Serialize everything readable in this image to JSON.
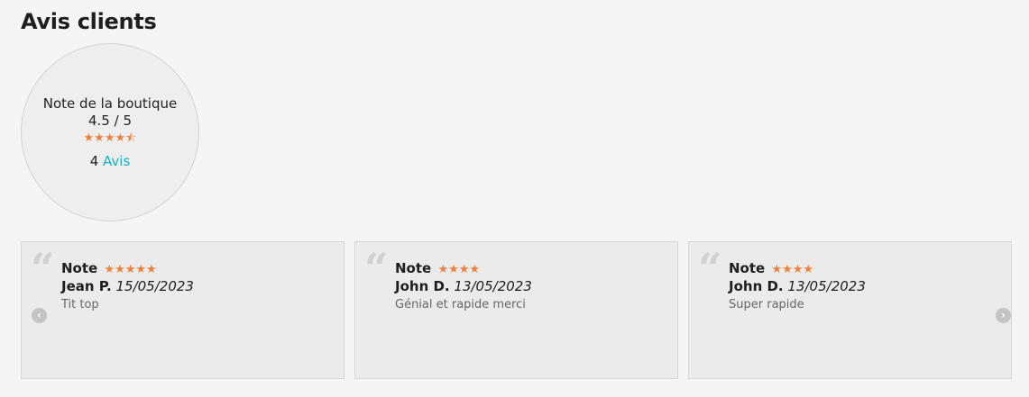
{
  "heading": "Avis clients",
  "summary": {
    "title": "Note de la boutique",
    "score": "4.5 / 5",
    "stars": "★★★★",
    "half_star": "⯪",
    "count": "4",
    "reviews_link": "Avis",
    "rating": 4.5
  },
  "reviews": [
    {
      "note_label": "Note",
      "stars": "★★★★★",
      "rating": 5,
      "author": "Jean P.",
      "date": "15/05/2023",
      "text": "Tit top"
    },
    {
      "note_label": "Note",
      "stars": "★★★★",
      "rating": 4,
      "author": "John D.",
      "date": "13/05/2023",
      "text": "Génial et rapide merci"
    },
    {
      "note_label": "Note",
      "stars": "★★★★",
      "rating": 4,
      "author": "John D.",
      "date": "13/05/2023",
      "text": "Super rapide"
    }
  ],
  "carousel": {
    "prev_icon": "‹",
    "next_icon": "›"
  },
  "colors": {
    "star": "#ef7f3e",
    "link": "#1ab0c6",
    "background": "#f5f5f5",
    "card": "#ebebeb"
  },
  "icons": {
    "quote": "quote-icon",
    "prev": "chevron-left-icon",
    "next": "chevron-right-icon",
    "star": "star-icon"
  }
}
